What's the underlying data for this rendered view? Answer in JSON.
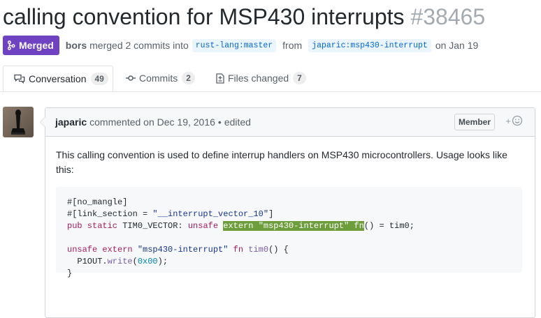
{
  "pr": {
    "title": "calling convention for MSP430 interrupts",
    "number": "#38465",
    "state": "Merged",
    "author": "bors",
    "merge_text": "merged 2 commits into",
    "base_branch": "rust-lang:master",
    "from_text": "from",
    "head_branch": "japaric:msp430-interrupt",
    "date_text": "on Jan 19"
  },
  "tabs": [
    {
      "label": "Conversation",
      "count": "49",
      "icon": "comment-discussion-icon"
    },
    {
      "label": "Commits",
      "count": "2",
      "icon": "git-commit-icon"
    },
    {
      "label": "Files changed",
      "count": "7",
      "icon": "file-diff-icon"
    }
  ],
  "comment": {
    "author": "japaric",
    "action": "commented on Dec 19, 2016",
    "edited": "edited",
    "role": "Member",
    "reaction": "+",
    "body": "This calling convention is used to define interrup handlers on MSP430 microcontrollers. Usage looks like this:",
    "code": {
      "line1": "#[no_mangle]",
      "line2a": "#[link_section = ",
      "line2b": "\"__interrupt_vector_10\"",
      "line2c": "]",
      "line3_kw1": "pub static",
      "line3_name": " TIM0_VECTOR: ",
      "line3_kw2": "unsafe",
      "line3_hl_kw": "extern",
      "line3_hl_str": "\"msp430-interrupt\"",
      "line3_hl_fn": "fn",
      "line3_rest": "() = tim0;",
      "line5_kw": "unsafe extern",
      "line5_str": "\"msp430-interrupt\"",
      "line5_kw2": "fn",
      "line5_fn": "tim0",
      "line5_rest": "() {",
      "line6_a": "  P1OUT.",
      "line6_fn": "write",
      "line6_b": "(",
      "line6_num": "0x00",
      "line6_c": ");",
      "line7": "}"
    }
  },
  "colors": {
    "merged": "#6f42c1",
    "link": "#0366d6",
    "highlight": "#6e9e3c"
  }
}
